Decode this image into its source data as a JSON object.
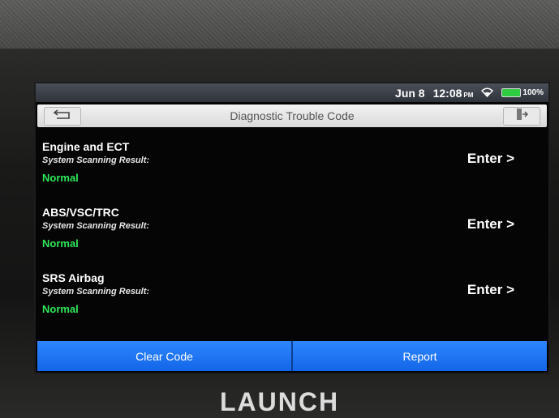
{
  "status_bar": {
    "date": "Jun 8",
    "time": "12:08",
    "ampm": "PM",
    "wifi_icon": "wifi-icon",
    "battery": "100%"
  },
  "title_bar": {
    "title": "Diagnostic Trouble Code",
    "back_icon": "back-arrow-icon",
    "exit_icon": "exit-icon"
  },
  "systems": [
    {
      "name": "Engine and ECT",
      "subtitle": "System Scanning Result:",
      "result": "Normal",
      "action": "Enter >"
    },
    {
      "name": "ABS/VSC/TRC",
      "subtitle": "System Scanning Result:",
      "result": "Normal",
      "action": "Enter >"
    },
    {
      "name": "SRS Airbag",
      "subtitle": "System Scanning Result:",
      "result": "Normal",
      "action": "Enter >"
    }
  ],
  "bottom_bar": {
    "clear_code": "Clear Code",
    "report": "Report"
  },
  "brand": "LAUNCH",
  "colors": {
    "accent_blue": "#1a73f0",
    "normal_green": "#2ee85a",
    "battery_green": "#2ecc40"
  }
}
